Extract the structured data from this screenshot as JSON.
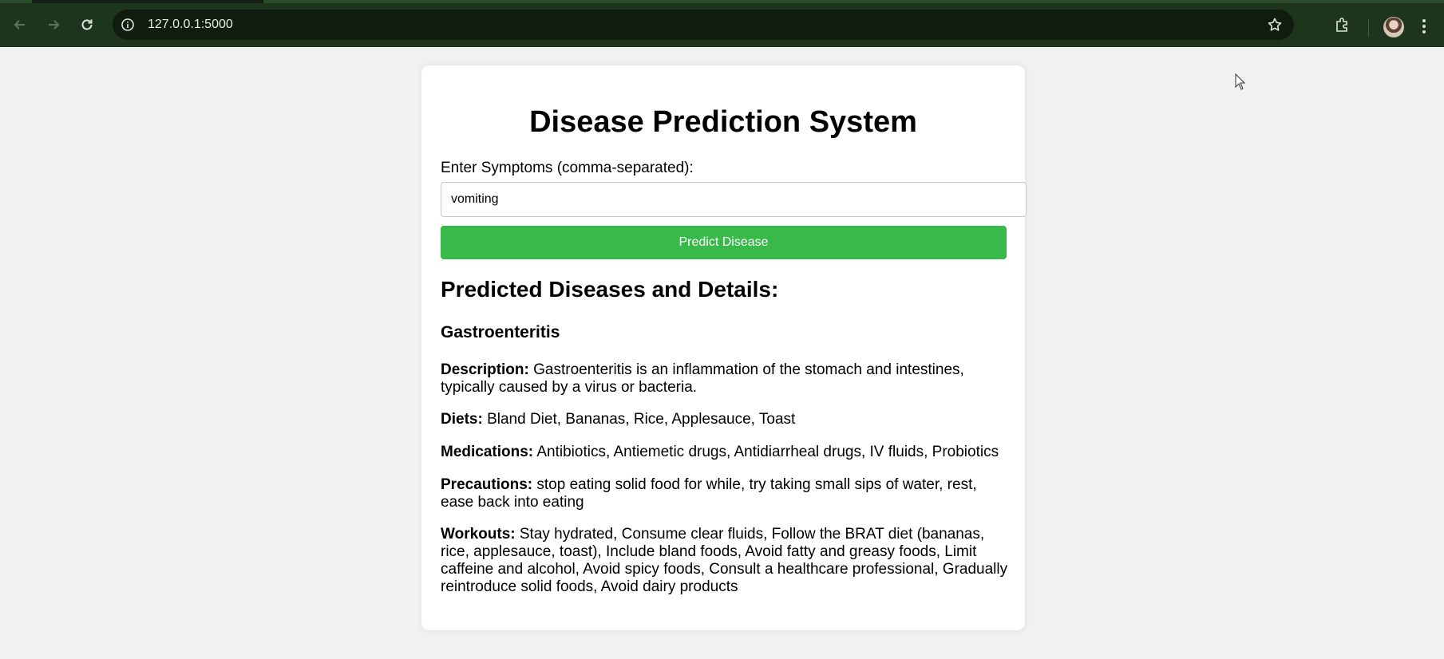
{
  "browser": {
    "url": "127.0.0.1:5000",
    "icons": [
      "back-arrow-icon",
      "forward-arrow-icon",
      "reload-icon",
      "site-info-icon",
      "bookmark-star-icon",
      "extensions-puzzle-icon",
      "profile-avatar",
      "kebab-menu-icon"
    ]
  },
  "page": {
    "title": "Disease Prediction System",
    "symptoms_label": "Enter Symptoms (comma-separated):",
    "symptoms_value": "vomiting",
    "predict_button": "Predict Disease",
    "results_heading": "Predicted Diseases and Details:"
  },
  "result": {
    "disease": "Gastroenteritis",
    "description_label": "Description:",
    "description": "Gastroenteritis is an inflammation of the stomach and intestines, typically caused by a virus or bacteria.",
    "diets_label": "Diets:",
    "diets": "Bland Diet, Bananas, Rice, Applesauce, Toast",
    "medications_label": "Medications:",
    "medications": "Antibiotics, Antiemetic drugs, Antidiarrheal drugs, IV fluids, Probiotics",
    "precautions_label": "Precautions:",
    "precautions": "stop eating solid food for while, try taking small sips of water, rest, ease back into eating",
    "workouts_label": "Workouts:",
    "workouts": "Stay hydrated, Consume clear fluids, Follow the BRAT diet (bananas, rice, applesauce, toast), Include bland foods, Avoid fatty and greasy foods, Limit caffeine and alcohol, Avoid spicy foods, Consult a healthcare professional, Gradually reintroduce solid foods, Avoid dairy products"
  },
  "colors": {
    "button_bg": "#38b94a",
    "chrome_bg": "#1d351d",
    "page_bg": "#f0f2f1"
  }
}
